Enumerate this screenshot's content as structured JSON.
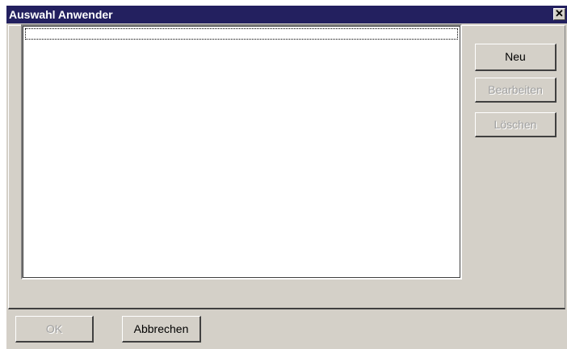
{
  "window": {
    "title": "Auswahl Anwender",
    "close_glyph": "✕"
  },
  "list": {
    "items": []
  },
  "side_buttons": {
    "new_label": "Neu",
    "edit_label": "Bearbeiten",
    "delete_label": "Löschen"
  },
  "footer_buttons": {
    "ok_label": "OK",
    "cancel_label": "Abbrechen"
  },
  "colors": {
    "titlebar": "#23205f",
    "dialog_face": "#d4d0c8",
    "disabled_text": "#a0a0a0"
  }
}
